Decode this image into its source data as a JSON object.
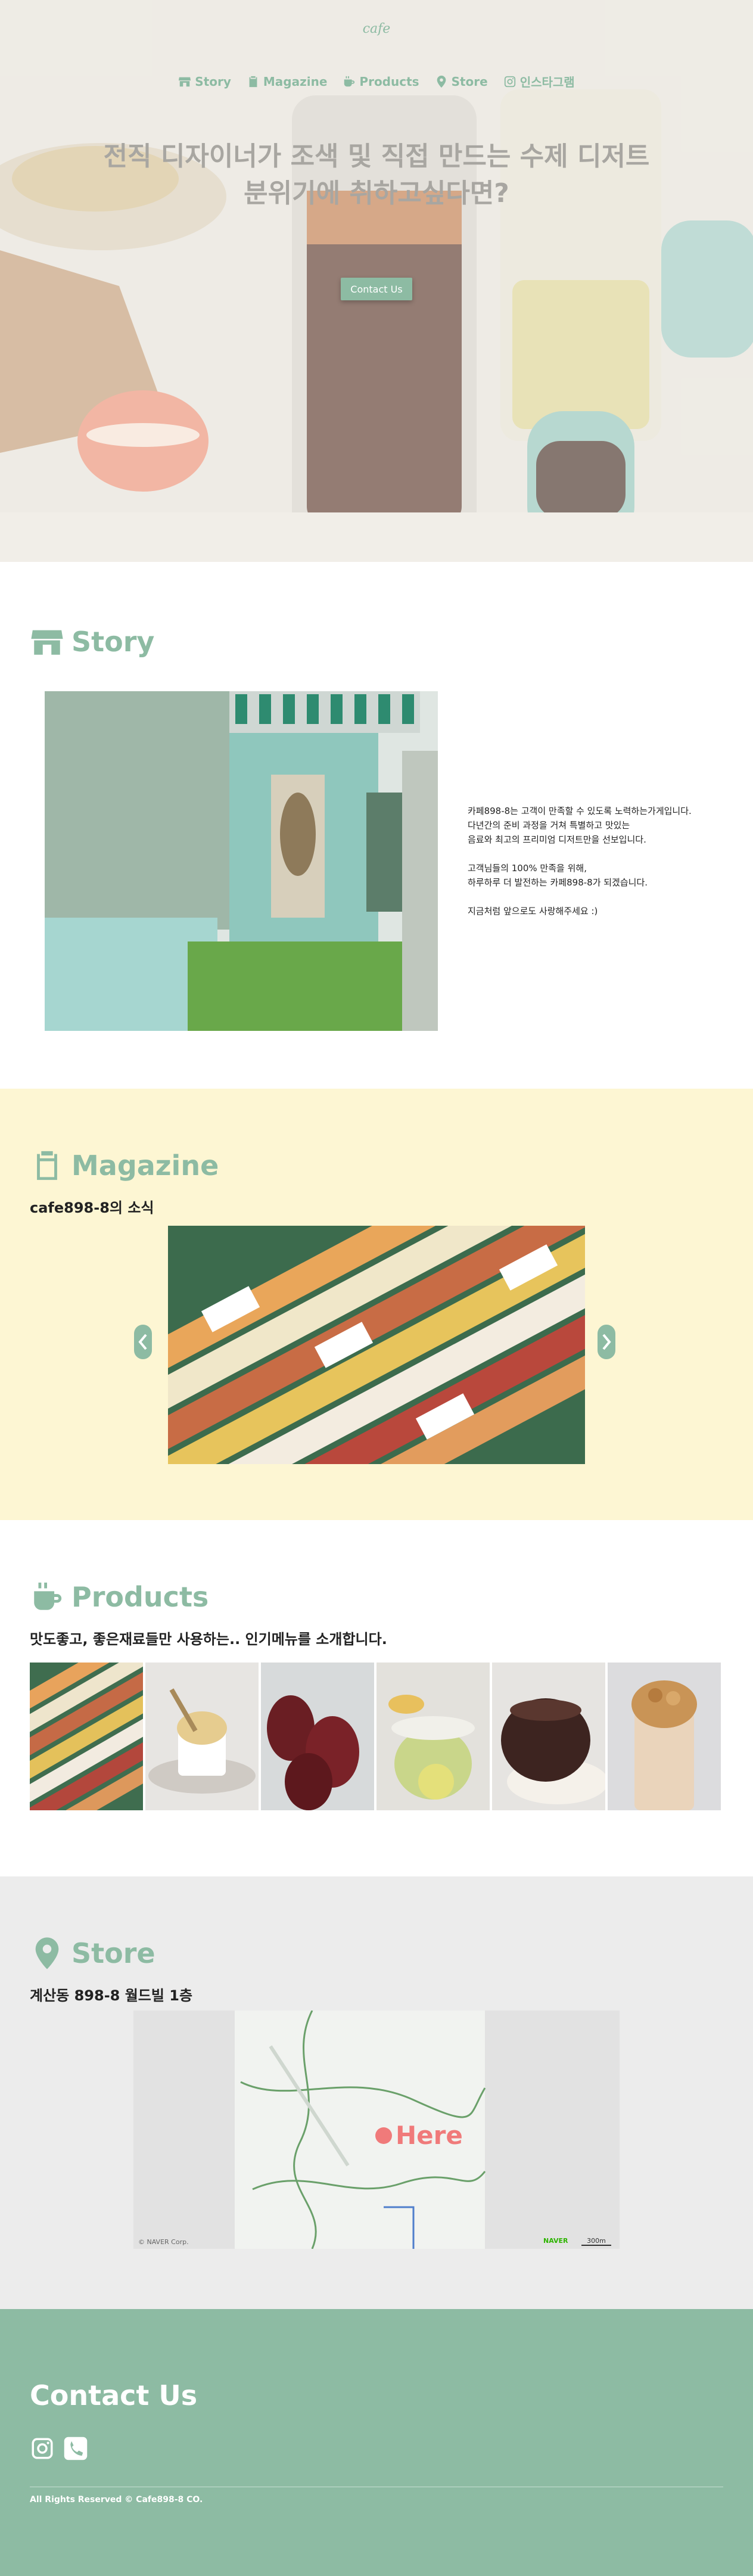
{
  "header": {
    "logo": "cafe",
    "nav": [
      "Story",
      "Magazine",
      "Products",
      "Store",
      "인스타그램"
    ]
  },
  "hero": {
    "title_line1": "전직 디자이너가 조색 및 직접 만드는 수제 디저트",
    "title_line2": "분위기에 취하고싶다면?",
    "button": "Contact Us"
  },
  "story": {
    "title": "Story",
    "paragraphs": [
      "카페898-8는 고객이 만족할 수 있도록 노력하는가게입니다.\n다년간의 준비 과정을 거쳐 특별하고 맛있는\n음료와 최고의 프리미엄 디저트만을 선보입니다.",
      "고객님들의 100% 만족을 위해,\n하루하루 더 발전하는 카페898-8가 되겠습니다.",
      "지금처럼 앞으로도 사랑해주세요 :)"
    ]
  },
  "magazine": {
    "title": "Magazine",
    "subtitle": "cafe898-8의 소식"
  },
  "products": {
    "title": "Products",
    "subtitle": "맛도좋고, 좋은재료들만 사용하는.. 인기메뉴를 소개합니다."
  },
  "store": {
    "title": "Store",
    "address": "계산동 898-8 월드빌 1층",
    "map_here": "Here",
    "map_credit": "© NAVER Corp.",
    "map_brand": "NAVER",
    "map_scale": "300m"
  },
  "footer": {
    "title": "Contact Us",
    "copyright": "All Rights Reserved © Cafe898-8 CO."
  },
  "colors": {
    "accent": "#8dbba3",
    "magazine_bg": "#fdf6d3",
    "store_bg": "#ececec"
  }
}
